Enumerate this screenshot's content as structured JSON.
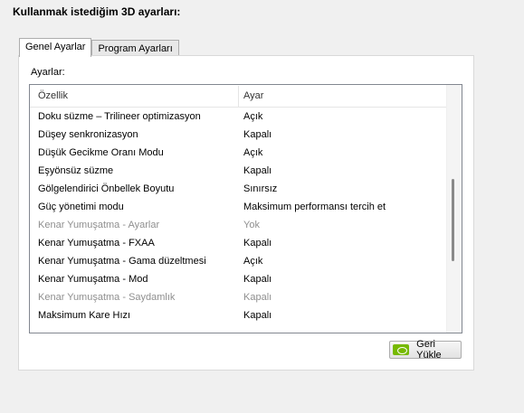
{
  "heading": "Kullanmak istediğim 3D ayarları:",
  "tabs": [
    {
      "label": "Genel Ayarlar",
      "active": true
    },
    {
      "label": "Program Ayarları",
      "active": false
    }
  ],
  "panel": {
    "label": "Ayarlar:",
    "columns": {
      "feature": "Özellik",
      "value": "Ayar"
    },
    "rows": [
      {
        "feature": "Doku süzme – Trilineer optimizasyon",
        "value": "Açık",
        "dim": false
      },
      {
        "feature": "Düşey senkronizasyon",
        "value": "Kapalı",
        "dim": false
      },
      {
        "feature": "Düşük Gecikme Oranı Modu",
        "value": "Açık",
        "dim": false
      },
      {
        "feature": "Eşyönsüz süzme",
        "value": "Kapalı",
        "dim": false
      },
      {
        "feature": "Gölgelendirici Önbellek Boyutu",
        "value": "Sınırsız",
        "dim": false
      },
      {
        "feature": "Güç yönetimi modu",
        "value": "Maksimum performansı tercih et",
        "dim": false
      },
      {
        "feature": "Kenar Yumuşatma - Ayarlar",
        "value": "Yok",
        "dim": true
      },
      {
        "feature": "Kenar Yumuşatma - FXAA",
        "value": "Kapalı",
        "dim": false
      },
      {
        "feature": "Kenar Yumuşatma - Gama düzeltmesi",
        "value": "Açık",
        "dim": false
      },
      {
        "feature": "Kenar Yumuşatma - Mod",
        "value": "Kapalı",
        "dim": false
      },
      {
        "feature": "Kenar Yumuşatma - Saydamlık",
        "value": "Kapalı",
        "dim": true
      },
      {
        "feature": "Maksimum Kare Hızı",
        "value": "Kapalı",
        "dim": false
      }
    ]
  },
  "reset_button": {
    "label": "Geri Yükle",
    "icon": "nvidia-logo-icon"
  },
  "colors": {
    "accent_green": "#76b900",
    "dim_text": "#8f8f8f"
  }
}
